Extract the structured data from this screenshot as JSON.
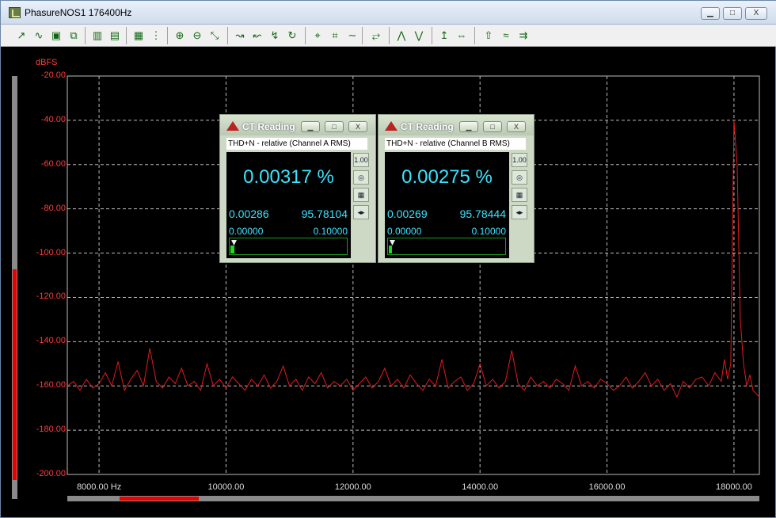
{
  "window": {
    "title": "PhasureNOS1 176400Hz",
    "minimize": "▁",
    "maximize": "□",
    "close": "X"
  },
  "toolbar": {
    "icons": [
      "zoom-in-icon",
      "wave-icon",
      "save-icon",
      "copy-icon",
      "chart-icon",
      "grid-icon",
      "calc-icon",
      "list-icon",
      "zoom-x-icon",
      "zoom-y-icon",
      "fit-icon",
      "curve-a-icon",
      "curve-b-icon",
      "curve-c-icon",
      "curve-d-icon",
      "cursor-a-icon",
      "cursor-b-icon",
      "sine-icon",
      "overlay-icon",
      "peak-icon",
      "trough-icon",
      "marker-icon",
      "arrows-icon",
      "up-icon",
      "wave2-icon",
      "settings-icon"
    ],
    "glyphs": [
      "↗",
      "∿",
      "▣",
      "⧉",
      "▥",
      "▤",
      "▦",
      "⋮",
      "⊕",
      "⊖",
      "⤡",
      "↝",
      "↜",
      "↯",
      "↻",
      "⌖",
      "⌗",
      "∼",
      "⥂",
      "⋀",
      "⋁",
      "↥",
      "⇔",
      "⇧",
      "≈",
      "⇉"
    ]
  },
  "plot": {
    "y_unit": "dBFS",
    "trace_color": "#e31b1b",
    "axis_color": "#ff3c3c",
    "grid": true
  },
  "chart_data": {
    "type": "line",
    "title": "",
    "xlabel": "",
    "ylabel": "dBFS",
    "xlim": [
      7500,
      18400
    ],
    "ylim": [
      -200,
      -20
    ],
    "y_ticks": [
      "-20.00",
      "-40.00",
      "-60.00",
      "-80.00",
      "-100.00",
      "-120.00",
      "-140.00",
      "-160.00",
      "-180.00",
      "-200.00"
    ],
    "x_ticks": [
      "8000.00 Hz",
      "10000.00",
      "12000.00",
      "14000.00",
      "16000.00",
      "18000.00"
    ],
    "series": [
      {
        "x": [
          7500,
          7600,
          7700,
          7800,
          7900,
          8000,
          8100,
          8200,
          8300,
          8400,
          8500,
          8600,
          8700,
          8800,
          8900,
          9000,
          9100,
          9200,
          9300,
          9400,
          9500,
          9600,
          9700,
          9800,
          9900,
          10000,
          10100,
          10200,
          10300,
          10400,
          10500,
          10600,
          10700,
          10800,
          10900,
          11000,
          11100,
          11200,
          11300,
          11400,
          11500,
          11600,
          11700,
          11800,
          11900,
          12000,
          12100,
          12200,
          12300,
          12400,
          12500,
          12600,
          12700,
          12800,
          12900,
          13000,
          13100,
          13200,
          13300,
          13400,
          13500,
          13600,
          13700,
          13800,
          13900,
          14000,
          14100,
          14200,
          14300,
          14400,
          14500,
          14600,
          14700,
          14800,
          14900,
          15000,
          15100,
          15200,
          15300,
          15400,
          15500,
          15600,
          15700,
          15800,
          15900,
          16000,
          16100,
          16200,
          16300,
          16400,
          16500,
          16600,
          16700,
          16800,
          16900,
          17000,
          17100,
          17200,
          17300,
          17400,
          17500,
          17600,
          17700,
          17800,
          17850,
          17900,
          17950,
          18000,
          18050,
          18100,
          18150,
          18200,
          18250,
          18300,
          18400
        ],
        "y": [
          -160,
          -158,
          -162,
          -157,
          -161,
          -159,
          -154,
          -160,
          -149,
          -162,
          -157,
          -153,
          -160,
          -143,
          -158,
          -161,
          -156,
          -159,
          -152,
          -160,
          -158,
          -162,
          -150,
          -160,
          -157,
          -161,
          -156,
          -159,
          -162,
          -157,
          -160,
          -155,
          -161,
          -158,
          -151,
          -160,
          -157,
          -162,
          -156,
          -159,
          -154,
          -161,
          -158,
          -160,
          -157,
          -162,
          -159,
          -156,
          -161,
          -158,
          -152,
          -160,
          -157,
          -161,
          -155,
          -159,
          -162,
          -157,
          -160,
          -148,
          -161,
          -158,
          -156,
          -162,
          -159,
          -150,
          -160,
          -157,
          -161,
          -158,
          -144,
          -159,
          -162,
          -156,
          -160,
          -158,
          -161,
          -157,
          -159,
          -162,
          -151,
          -160,
          -158,
          -161,
          -157,
          -159,
          -162,
          -160,
          -156,
          -161,
          -158,
          -154,
          -160,
          -157,
          -162,
          -159,
          -165,
          -158,
          -161,
          -157,
          -156,
          -160,
          -154,
          -158,
          -148,
          -157,
          -150,
          -40,
          -60,
          -130,
          -150,
          -160,
          -155,
          -162,
          -165
        ]
      }
    ]
  },
  "ct_a": {
    "title": "CT Reading",
    "subtitle": "THD+N - relative (Channel A RMS)",
    "main": "0.00317 %",
    "left_value": "0.00286",
    "right_value": "95.78104",
    "scale_min": "0.00000",
    "scale_max": "0.10000",
    "level": 0.0317,
    "side": [
      "1.00",
      "◎",
      "▦",
      "◂▸"
    ]
  },
  "ct_b": {
    "title": "CT Reading",
    "subtitle": "THD+N - relative (Channel B RMS)",
    "main": "0.00275 %",
    "left_value": "0.00269",
    "right_value": "95.78444",
    "scale_min": "0.00000",
    "scale_max": "0.10000",
    "level": 0.0275,
    "side": [
      "1.00",
      "◎",
      "▦",
      "◂▸"
    ]
  }
}
